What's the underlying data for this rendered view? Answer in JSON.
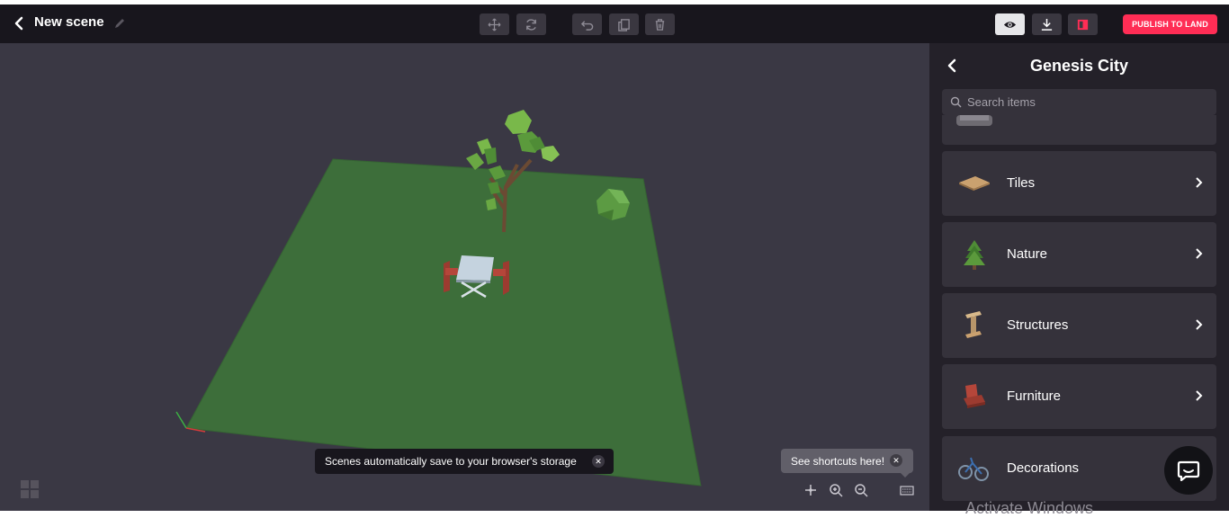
{
  "header": {
    "scene_title": "New scene",
    "publish_label": "PUBLISH TO LAND"
  },
  "sidebar": {
    "title": "Genesis City",
    "search_placeholder": "Search items",
    "categories": [
      {
        "label": "Tiles"
      },
      {
        "label": "Nature"
      },
      {
        "label": "Structures"
      },
      {
        "label": "Furniture"
      },
      {
        "label": "Decorations"
      }
    ]
  },
  "viewport": {
    "save_toast": "Scenes automatically save to your browser's storage",
    "shortcuts_toast": "See shortcuts here!"
  },
  "watermark": "Activate Windows",
  "colors": {
    "publish": "#ff2d55",
    "topbar": "#18161d",
    "viewport_bg": "#3a3844",
    "sidebar_bg": "#242129",
    "ground": "#3d6e3a"
  }
}
